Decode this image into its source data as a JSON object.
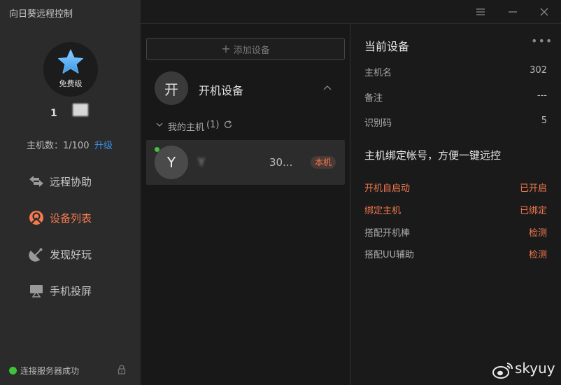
{
  "app": {
    "title": "向日葵远程控制"
  },
  "profile": {
    "tier": "免费级",
    "username": "1",
    "host_count": "主机数：1/100",
    "upgrade": "升级"
  },
  "nav": {
    "remote": "远程协助",
    "devices": "设备列表",
    "discover": "发现好玩",
    "screen": "手机投屏"
  },
  "status": {
    "text": "连接服务器成功"
  },
  "middle": {
    "add_device": "添加设备",
    "add_plus": "+",
    "group_avatar": "开",
    "group_title": "开机设备",
    "sub_title": "我的主机",
    "sub_count": "(1)",
    "device_avatar": "Y",
    "device_name": "Y",
    "device_name_tail": "30...",
    "device_badge": "本机"
  },
  "right": {
    "title": "当前设备",
    "more": "•••",
    "host_name_label": "主机名",
    "host_name_value": "302",
    "note_label": "备注",
    "note_value": "---",
    "id_label": "识别码",
    "id_value": "5",
    "bind_heading": "主机绑定帐号，方便一键远控",
    "autostart_label": "开机自启动",
    "autostart_value": "已开启",
    "bind_label": "绑定主机",
    "bind_value": "已绑定",
    "stick_label": "搭配开机棒",
    "stick_value": "检测",
    "uu_label": "搭配UU辅助",
    "uu_value": "检测"
  },
  "watermark": {
    "text": "skyuy"
  },
  "colors": {
    "accent": "#f47a4f",
    "link": "#3b8fe6",
    "online": "#3ec43a"
  }
}
